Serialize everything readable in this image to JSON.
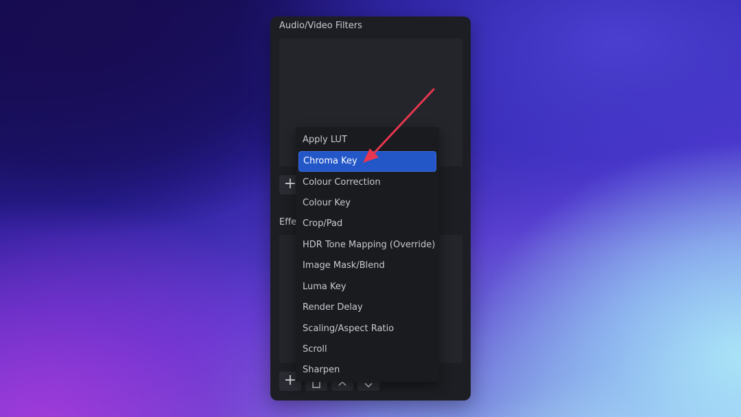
{
  "panel": {
    "title": "Audio/Video Filters",
    "effects_title": "Effe"
  },
  "toolbar": {
    "add_icon": "+"
  },
  "dropdown": {
    "items": [
      {
        "label": "Apply LUT",
        "selected": false
      },
      {
        "label": "Chroma Key",
        "selected": true
      },
      {
        "label": "Colour Correction",
        "selected": false
      },
      {
        "label": "Colour Key",
        "selected": false
      },
      {
        "label": "Crop/Pad",
        "selected": false
      },
      {
        "label": "HDR Tone Mapping (Override)",
        "selected": false
      },
      {
        "label": "Image Mask/Blend",
        "selected": false
      },
      {
        "label": "Luma Key",
        "selected": false
      },
      {
        "label": "Render Delay",
        "selected": false
      },
      {
        "label": "Scaling/Aspect Ratio",
        "selected": false
      },
      {
        "label": "Scroll",
        "selected": false
      },
      {
        "label": "Sharpen",
        "selected": false
      }
    ]
  },
  "colors": {
    "selection": "#2357c8",
    "arrow": "#e8364f",
    "panel_bg": "#1d1e23"
  }
}
